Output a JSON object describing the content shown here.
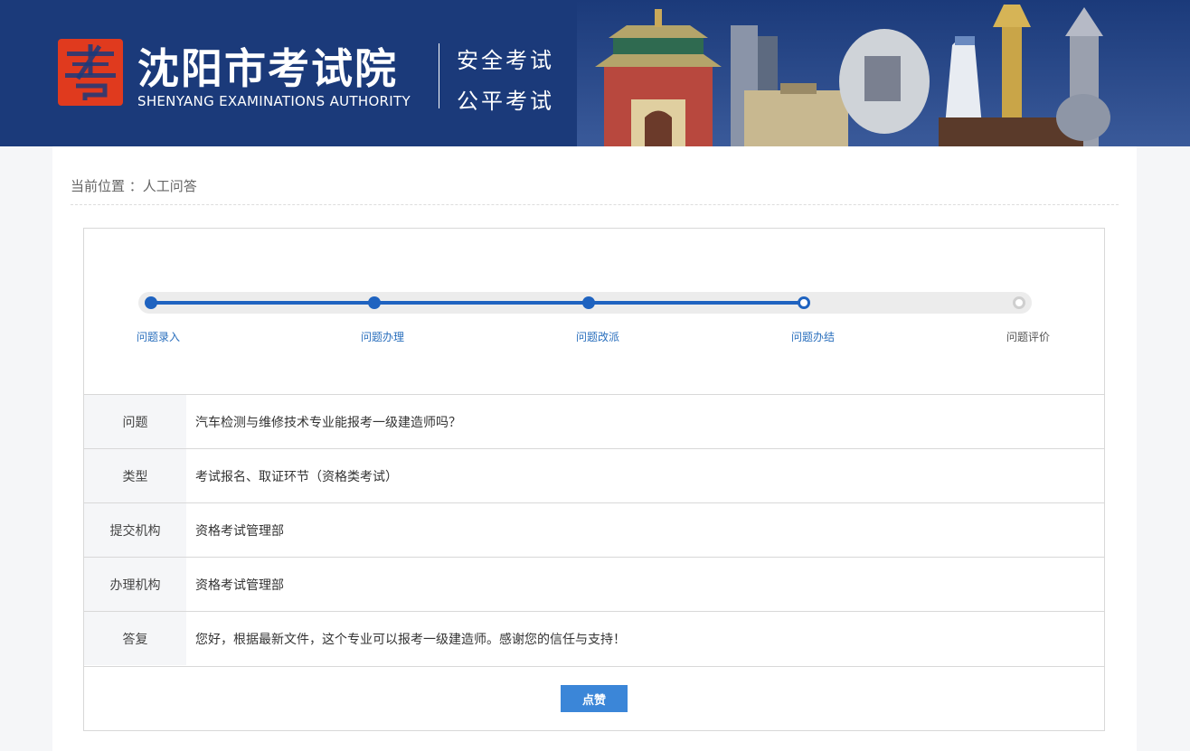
{
  "header": {
    "title": "沈阳市考试院",
    "subtitle": "SHENYANG EXAMINATIONS AUTHORITY",
    "slogans": [
      "安全考试",
      "公平考试"
    ],
    "logo_icon": "kao-character-logo",
    "colors": {
      "background": "#1b3a7a",
      "logo": "#e03a1e"
    }
  },
  "breadcrumb": {
    "text": "当前位置 ：人工问答"
  },
  "progress": {
    "steps": [
      {
        "label": "问题录入",
        "state": "done"
      },
      {
        "label": "问题办理",
        "state": "done"
      },
      {
        "label": "问题改派",
        "state": "done"
      },
      {
        "label": "问题办结",
        "state": "current"
      },
      {
        "label": "问题评价",
        "state": "todo"
      }
    ],
    "colors": {
      "active": "#1f63c0",
      "inactive": "#cfcfcf"
    }
  },
  "details": [
    {
      "label": "问题",
      "value": "汽车检测与维修技术专业能报考一级建造师吗？"
    },
    {
      "label": "类型",
      "value": "考试报名、取证环节（资格类考试）"
    },
    {
      "label": "提交机构",
      "value": "资格考试管理部"
    },
    {
      "label": "办理机构",
      "value": "资格考试管理部"
    },
    {
      "label": "答复",
      "value": "您好，根据最新文件，这个专业可以报考一级建造师。感谢您的信任与支持！"
    }
  ],
  "actions": {
    "like_label": "点赞",
    "like_color": "#3b86d8"
  }
}
